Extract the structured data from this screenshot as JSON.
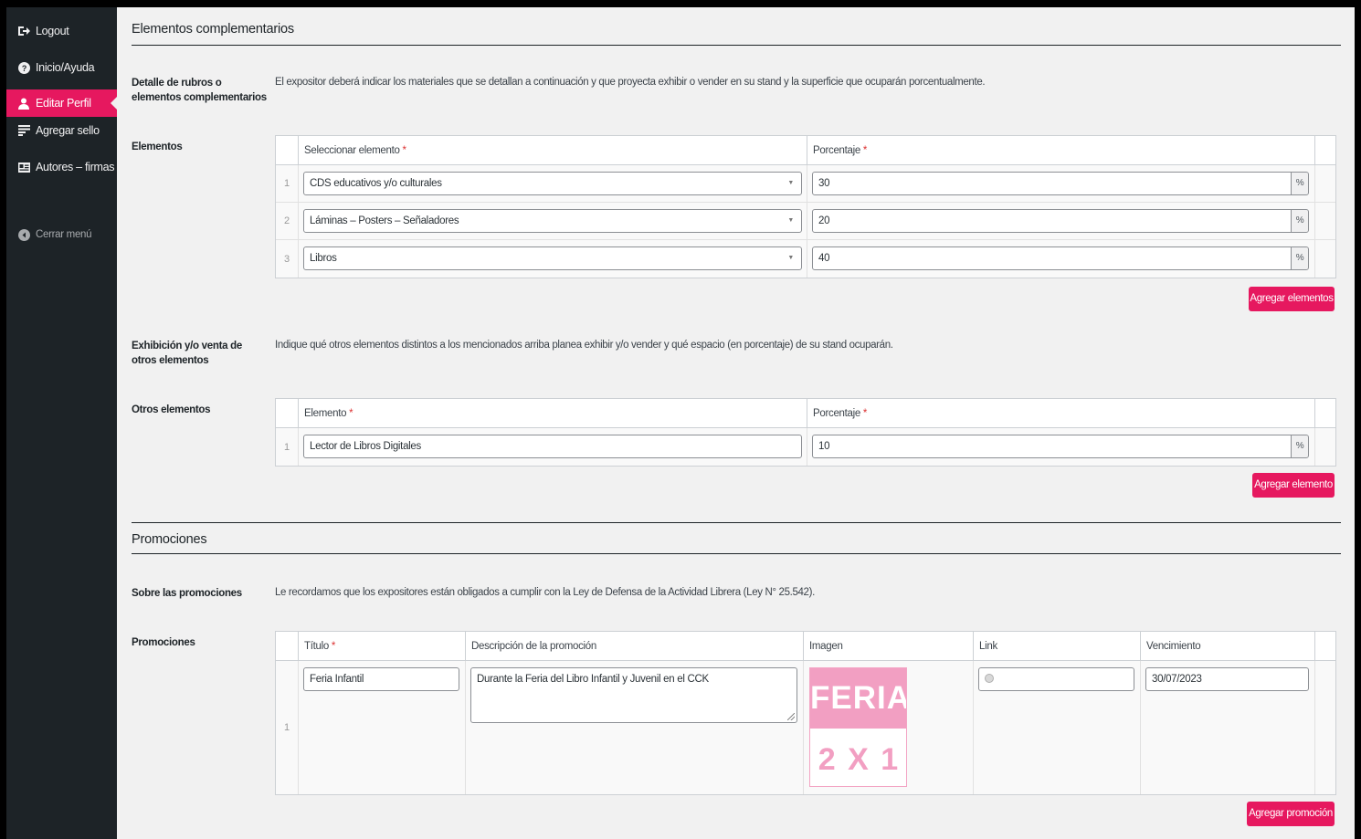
{
  "sidebar": {
    "items": [
      {
        "label": "Logout",
        "icon": "logout-icon"
      },
      {
        "label": "Inicio/Ayuda",
        "icon": "help-icon"
      },
      {
        "label": "Editar Perfil",
        "icon": "user-icon",
        "active": true
      },
      {
        "label": "Agregar sello",
        "icon": "list-icon"
      },
      {
        "label": "Autores – firmas",
        "icon": "id-card-icon"
      }
    ],
    "collapse_label": "Cerrar menú"
  },
  "section1": {
    "title": "Elementos complementarios",
    "detalle_label": "Detalle de rubros o elementos complementarios",
    "detalle_desc": "El expositor deberá indicar los materiales que se detallan a continuación y que proyecta exhibir o vender en su stand y la superficie que ocuparán porcentualmente.",
    "elementos_label": "Elementos",
    "elementos_table": {
      "col_element": "Seleccionar elemento",
      "col_percent": "Porcentaje",
      "required_mark": "*",
      "rows": [
        {
          "num": "1",
          "element": "CDS educativos y/o culturales",
          "percent": "30"
        },
        {
          "num": "2",
          "element": "Láminas – Posters – Señaladores",
          "percent": "20"
        },
        {
          "num": "3",
          "element": "Libros",
          "percent": "40"
        }
      ],
      "percent_suffix": "%"
    },
    "add_elementos_button": "Agregar elementos",
    "otros_exhibicion_label": "Exhibición y/o venta de otros elementos",
    "otros_exhibicion_desc": "Indique qué otros elementos distintos a los mencionados arriba planea exhibir y/o vender y qué espacio (en porcentaje) de su stand ocuparán.",
    "otros_label": "Otros elementos",
    "otros_table": {
      "col_element": "Elemento",
      "col_percent": "Porcentaje",
      "rows": [
        {
          "num": "1",
          "element": "Lector de Libros Digitales",
          "percent": "10"
        }
      ]
    },
    "add_elemento_button": "Agregar elemento"
  },
  "section2": {
    "title": "Promociones",
    "sobre_label": "Sobre las promociones",
    "sobre_desc": "Le recordamos que los expositores están obligados a cumplir con la Ley de Defensa de la Actividad Librera (Ley N° 25.542).",
    "promociones_label": "Promociones",
    "table": {
      "col_titulo": "Título",
      "col_descripcion": "Descripción de la promoción",
      "col_imagen": "Imagen",
      "col_link": "Link",
      "col_vencimiento": "Vencimiento",
      "rows": [
        {
          "num": "1",
          "titulo": "Feria Infantil",
          "descripcion": "Durante la Feria del Libro Infantil y Juvenil en el CCK",
          "image_text_top": "FERIA",
          "image_text_bottom": "2 X 1",
          "link": "",
          "vencimiento": "30/07/2023"
        }
      ]
    },
    "add_promocion_button": "Agregar promoción"
  },
  "colors": {
    "accent": "#e6185f",
    "sidebar_bg": "#1d2327",
    "content_bg": "#f1f1f1"
  }
}
